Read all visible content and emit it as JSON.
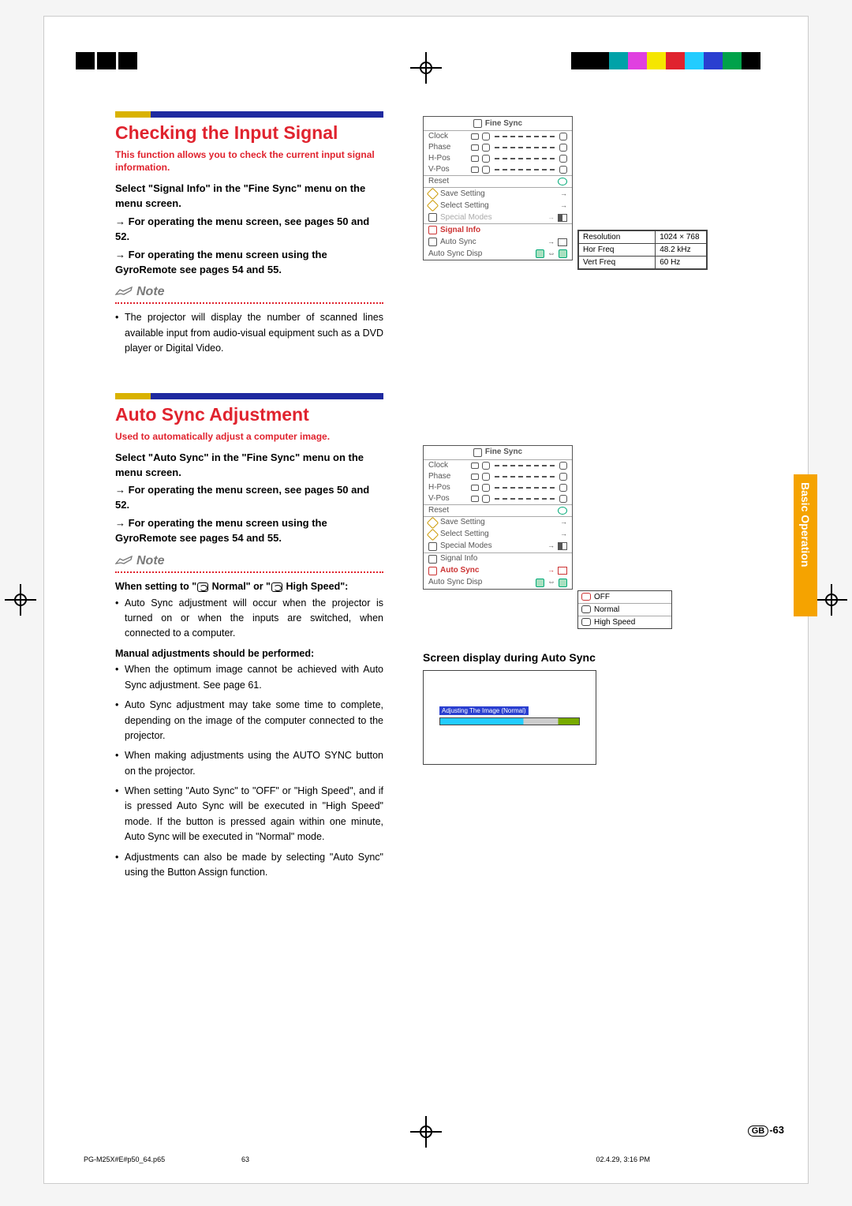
{
  "crop_colors": [
    "#000000",
    "#000000",
    "#00a2a8",
    "#e040e0",
    "#f5e600",
    "#e0232e",
    "#2cf",
    "#2a3fd0",
    "#00a24a",
    "#000000"
  ],
  "side_tab": "Basic Operation",
  "page_number_prefix": "GB",
  "page_number": "-63",
  "footer": {
    "file": "PG-M25X#E#p50_64.p65",
    "page": "63",
    "timestamp": "02.4.29, 3:16 PM"
  },
  "section1": {
    "title": "Checking the Input Signal",
    "desc": "This function allows you to check the current input signal information.",
    "step1": "Select \"Signal Info\" in the \"Fine Sync\" menu on the menu screen.",
    "step2": "For operating the menu screen, see pages 50 and 52.",
    "step3": "For operating the menu screen using the GyroRemote see pages 54 and 55.",
    "note_label": "Note",
    "note_bullet": "The projector will display the number of scanned lines available input from audio-visual equipment such as a DVD player or Digital Video."
  },
  "osd1": {
    "title": "Fine Sync",
    "rows": {
      "clock": "Clock",
      "phase": "Phase",
      "hpos": "H-Pos",
      "vpos": "V-Pos",
      "reset": "Reset",
      "save": "Save Setting",
      "select": "Select Setting",
      "special": "Special Modes",
      "signal": "Signal Info",
      "auto": "Auto Sync",
      "disp": "Auto Sync Disp"
    }
  },
  "signal_info": {
    "r1a": "Resolution",
    "r1b": "1024 × 768",
    "r2a": "Hor Freq",
    "r2b": "48.2 kHz",
    "r3a": "Vert Freq",
    "r3b": "60   Hz"
  },
  "section2": {
    "title": "Auto Sync Adjustment",
    "desc": "Used to automatically adjust a computer image.",
    "step1": "Select \"Auto Sync\" in the \"Fine Sync\" menu on the menu screen.",
    "step2": "For operating the menu screen, see pages 50 and 52.",
    "step3": "For operating the menu screen using the GyroRemote see pages 54 and 55.",
    "note_label": "Note",
    "sub1a": "When setting to \"",
    "sub1b": " Normal\" or \"",
    "sub1c": " High Speed\":",
    "b1": "Auto Sync adjustment will occur when the projector is turned on or when the inputs are switched, when connected to a computer.",
    "sub2": "Manual adjustments should be performed:",
    "b2": "When the optimum image cannot be achieved with Auto Sync adjustment. See page 61.",
    "b3": "Auto Sync adjustment may take some time to complete, depending on the image of the computer connected to the projector.",
    "b4": "When making adjustments using the AUTO SYNC button on the projector.",
    "b5": "When setting \"Auto Sync\" to \"OFF\" or \"High Speed\", and if  is pressed Auto Sync will be executed in \"High Speed\" mode. If the button is pressed again within one minute, Auto Sync will be executed in \"Normal\" mode.",
    "b6": "Adjustments can also be made by selecting \"Auto Sync\" using the Button Assign function."
  },
  "sync_options": {
    "off": "OFF",
    "normal": "Normal",
    "high": "High Speed"
  },
  "screen_display_title": "Screen display during Auto Sync",
  "screen_bar_label": "Adjusting The Image (Normal)"
}
